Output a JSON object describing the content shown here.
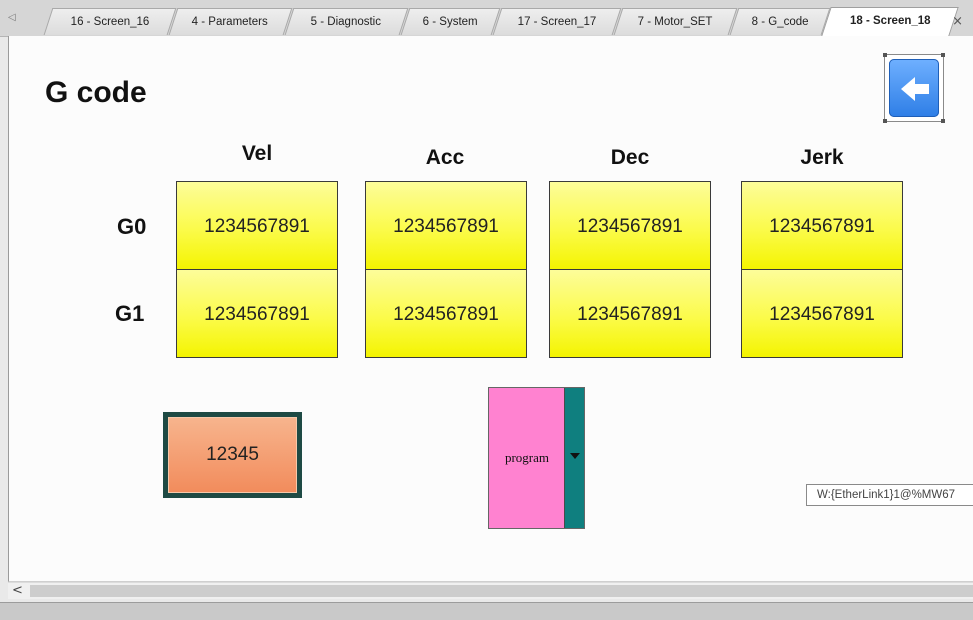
{
  "tabs": [
    {
      "label": "16 - Screen_16",
      "active": false
    },
    {
      "label": "4 - Parameters",
      "active": false
    },
    {
      "label": "5 - Diagnostic",
      "active": false
    },
    {
      "label": "6 - System",
      "active": false
    },
    {
      "label": "17 - Screen_17",
      "active": false
    },
    {
      "label": "7 - Motor_SET",
      "active": false
    },
    {
      "label": "8 - G_code",
      "active": false
    },
    {
      "label": "18 - Screen_18",
      "active": true
    }
  ],
  "tab_close_symbol": "×",
  "tab_scroll_left_symbol": "◁",
  "page": {
    "title": "G code",
    "back_button_icon": "back-arrow-icon"
  },
  "table": {
    "columns": [
      "Vel",
      "Acc",
      "Dec",
      "Jerk"
    ],
    "rows": [
      {
        "label": "G0",
        "values": [
          "1234567891",
          "1234567891",
          "1234567891",
          "1234567891"
        ]
      },
      {
        "label": "G1",
        "values": [
          "1234567891",
          "1234567891",
          "1234567891",
          "1234567891"
        ]
      }
    ]
  },
  "numeric_field": {
    "value": "12345"
  },
  "program_select": {
    "value": "program"
  },
  "tooltip": {
    "text": "W:{EtherLink1}1@%MW67"
  },
  "scrollbar": {
    "left_arrow": "<"
  },
  "colors": {
    "cell_yellow": "#fbfb4a",
    "field_orange": "#f28c5c",
    "field_frame": "#1e4a44",
    "select_pink": "#ff82d0",
    "select_teal": "#0f7f7f",
    "back_blue": "#2e7ee6"
  }
}
